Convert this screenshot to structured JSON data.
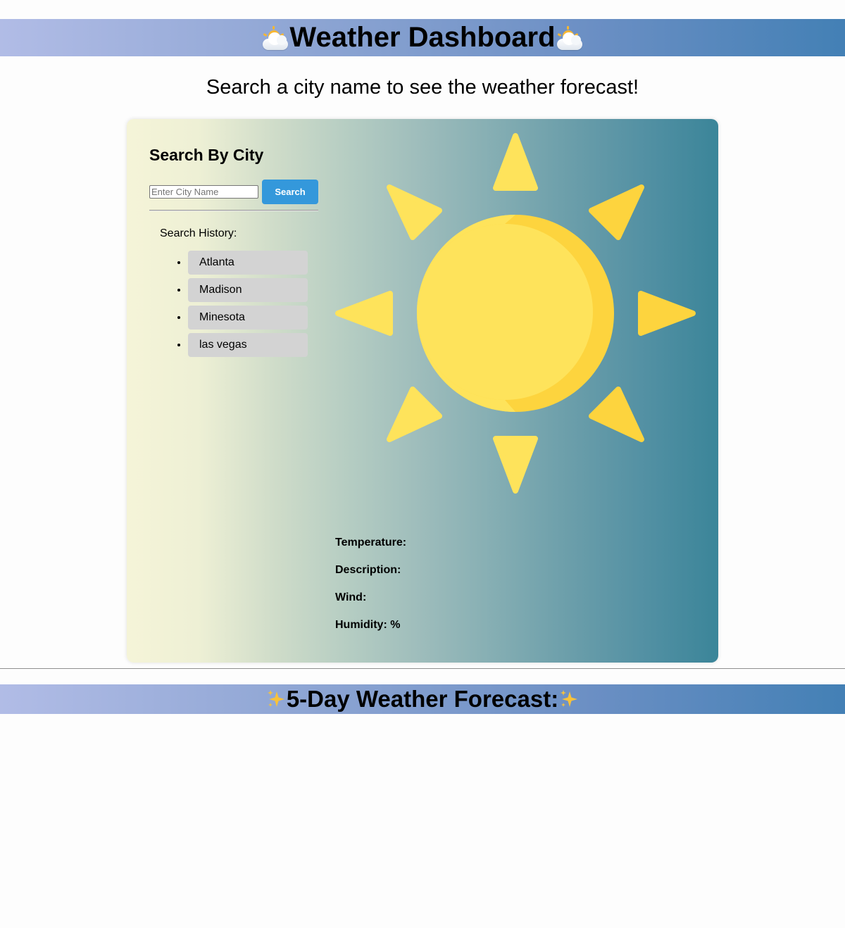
{
  "header": {
    "title": "Weather Dashboard",
    "left_icon": "sun-behind-cloud-icon",
    "right_icon": "sun-behind-cloud-icon"
  },
  "subtitle": "Search a city name to see the weather forecast!",
  "sidebar": {
    "heading": "Search By City",
    "search_placeholder": "Enter City Name",
    "search_value": "",
    "search_button_label": "Search",
    "history_label": "Search History:",
    "history": [
      {
        "label": "Atlanta"
      },
      {
        "label": "Madison"
      },
      {
        "label": "Minesota"
      },
      {
        "label": "las vegas"
      }
    ]
  },
  "current_weather": {
    "icon": "sun-icon",
    "temperature_label": "Temperature:",
    "description_label": "Description:",
    "wind_label": "Wind:",
    "humidity_label": "Humidity: %"
  },
  "forecast": {
    "title": "5-Day Weather Forecast:",
    "left_icon": "sparkles-icon",
    "right_icon": "sparkles-icon"
  },
  "colors": {
    "banner_gradient_start": "#b1bce6",
    "banner_gradient_end": "#4380b5",
    "card_gradient_start": "#f5f4d8",
    "card_gradient_end": "#3b8599",
    "search_button": "#3498db",
    "history_item_bg": "#d3d3d3",
    "sun_main": "#fee35b",
    "sun_shade": "#fdd43e"
  }
}
